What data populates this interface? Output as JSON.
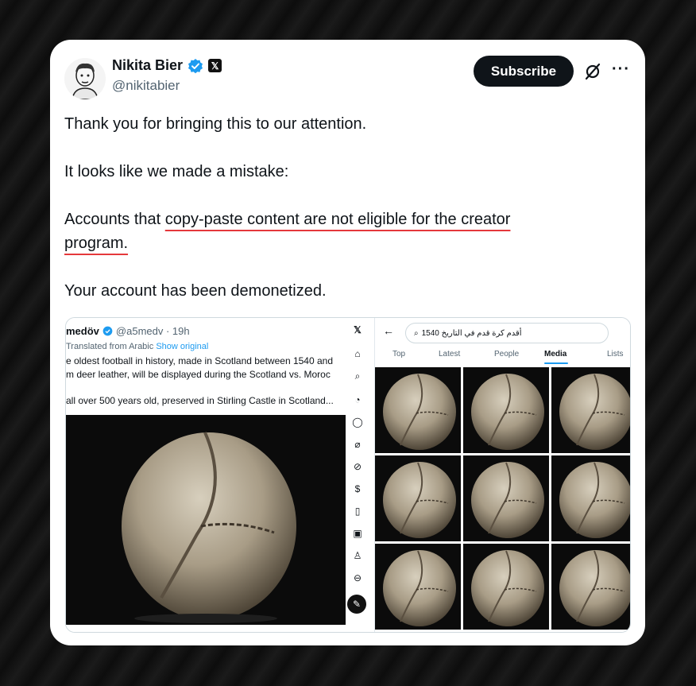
{
  "author": {
    "name": "Nikita Bier",
    "handle": "@nikitabier"
  },
  "actions": {
    "subscribe_label": "Subscribe"
  },
  "icons": {
    "verified": "verified-badge-icon",
    "x_affiliation": "x-logo-icon",
    "grok": "grok-icon",
    "more": "more-icon"
  },
  "tweet": {
    "line1": "Thank you for bringing this to our attention.",
    "line2": "It looks like we made a mistake:",
    "line3_pre": "Accounts that ",
    "line3_ul": "copy-paste content are not eligible for the creator",
    "line4_ul": "program.",
    "line5": "Your account has been demonetized."
  },
  "embedded_left": {
    "username": "medöv",
    "handle_time": "@a5medv · 19h",
    "translated": "Translated from Arabic",
    "show_original": "Show original",
    "text_line1": "e oldest football in history, made in Scotland between 1540 and",
    "text_line2": "m deer leather, will be displayed during the Scotland vs. Moroc",
    "text_line3": "all over 500 years old, preserved in Stirling Castle in Scotland..."
  },
  "embedded_right": {
    "search_query": "1540 أقدم كرة قدم في التاريخ",
    "tabs": [
      "Top",
      "Latest",
      "People",
      "Media",
      "Lists"
    ],
    "active_tab": "Media"
  },
  "colors": {
    "underline": "#e5383b",
    "link": "#1d9bf0",
    "verified": "#1d9bf0"
  }
}
